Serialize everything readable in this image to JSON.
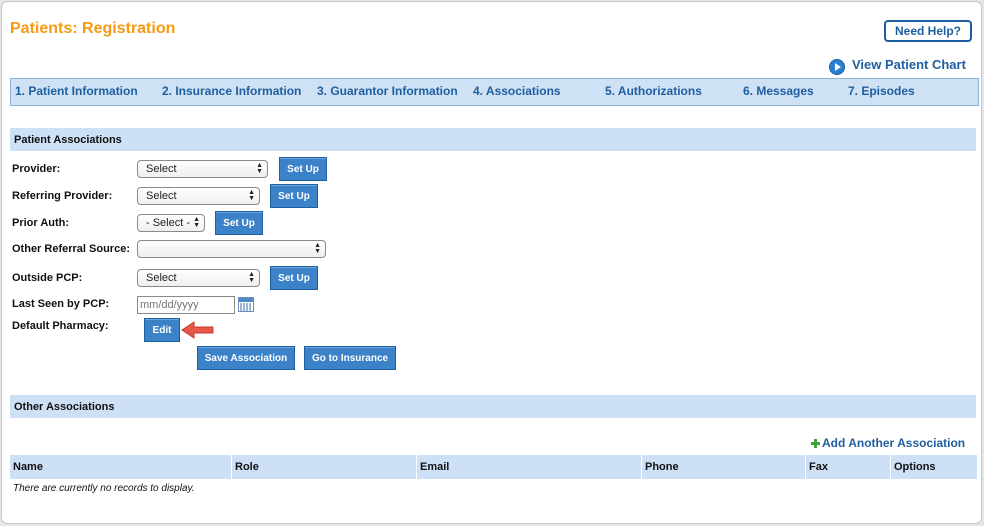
{
  "header": {
    "title": "Patients: Registration",
    "help_label": "Need Help?",
    "view_chart_label": "View Patient Chart"
  },
  "tabs": [
    {
      "label": "1. Patient Information"
    },
    {
      "label": "2. Insurance Information"
    },
    {
      "label": "3. Guarantor Information"
    },
    {
      "label": "4. Associations"
    },
    {
      "label": "5. Authorizations"
    },
    {
      "label": "6. Messages"
    },
    {
      "label": "7. Episodes"
    }
  ],
  "patient_associations": {
    "heading": "Patient Associations",
    "provider": {
      "label": "Provider:",
      "value": "Select",
      "button": "Set Up"
    },
    "referring_provider": {
      "label": "Referring Provider:",
      "value": "Select",
      "button": "Set Up"
    },
    "prior_auth": {
      "label": "Prior Auth:",
      "value": "- Select -",
      "button": "Set Up"
    },
    "other_referral": {
      "label": "Other Referral Source:",
      "value": ""
    },
    "outside_pcp": {
      "label": "Outside PCP:",
      "value": "Select",
      "button": "Set Up"
    },
    "last_seen": {
      "label": "Last Seen by PCP:",
      "placeholder": "mm/dd/yyyy"
    },
    "default_pharmacy": {
      "label": "Default Pharmacy:",
      "button": "Edit"
    },
    "save_label": "Save Association",
    "go_insurance_label": "Go to Insurance"
  },
  "other_associations": {
    "heading": "Other Associations",
    "add_label": "Add Another Association",
    "columns": [
      "Name",
      "Role",
      "Email",
      "Phone",
      "Fax",
      "Options"
    ],
    "empty_text": "There are currently no records to display."
  },
  "colors": {
    "title": "#f59a13",
    "link": "#1f5fa0",
    "button": "#3b82c9",
    "section_bg": "#cde0f5",
    "arrow": "#e8574a"
  },
  "icons": {
    "view_chart": "play-circle-icon",
    "calendar": "calendar-icon",
    "add": "plus-icon",
    "pointer": "red-arrow-icon"
  }
}
